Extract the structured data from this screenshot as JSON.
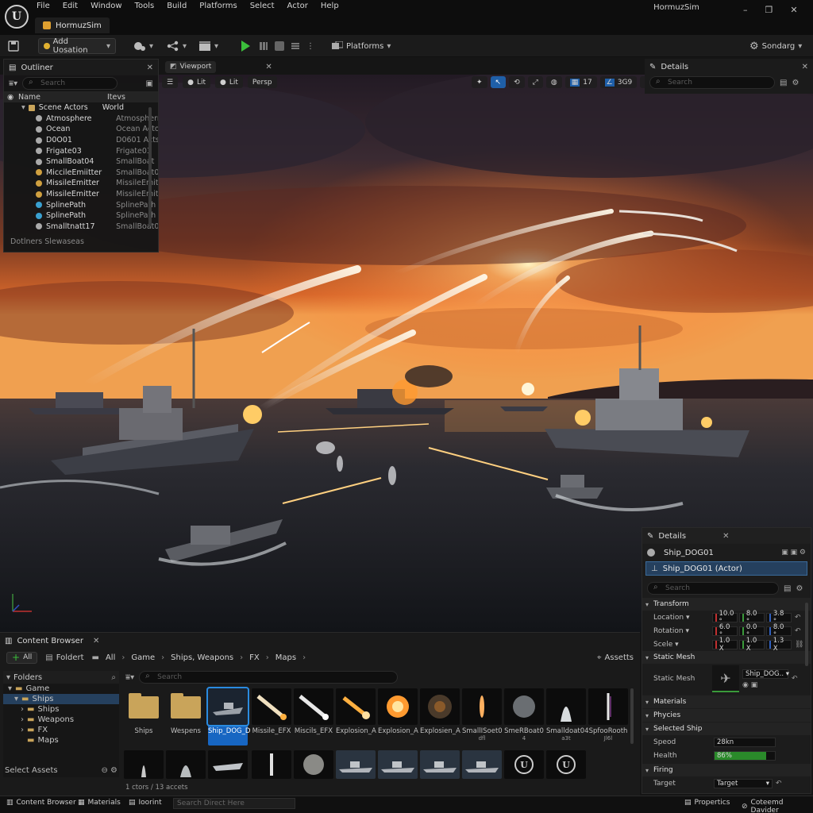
{
  "app": {
    "logo": "U",
    "menu": [
      "File",
      "Edit",
      "Window",
      "Tools",
      "Build",
      "Platforms",
      "Select",
      "Actor",
      "Help"
    ],
    "project_tab": "HormuzSim",
    "window_title": "HormuzSim",
    "win_controls": [
      "–",
      "❐",
      "✕"
    ]
  },
  "toolbar": {
    "add_label": "Add Uosation",
    "platforms_label": "Platforms",
    "settings_label": "Sondarg"
  },
  "outliner": {
    "title": "Outliner",
    "search_placeholder": "Search",
    "col_name": "Name",
    "col_type": "Itevs",
    "rows": [
      {
        "name": "Scene Actors",
        "type": "World"
      },
      {
        "name": "Atmosphere",
        "type": "Atmospherr"
      },
      {
        "name": "Ocean",
        "type": "Ocean Acto"
      },
      {
        "name": "D0O01",
        "type": "D0601 Acts"
      },
      {
        "name": "Frigate03",
        "type": "Frigate03"
      },
      {
        "name": "SmallBoat04",
        "type": "SmallBoat"
      },
      {
        "name": "MiccileEmiitter",
        "type": "SmallBoat0"
      },
      {
        "name": "MissileEmitter",
        "type": "MissileEmit"
      },
      {
        "name": "MissileEmitter",
        "type": "MissileEmit"
      },
      {
        "name": "SplinePath",
        "type": "SplinePath"
      },
      {
        "name": "SplinePath",
        "type": "SplinePath"
      },
      {
        "name": "Smalltnatt17",
        "type": "SmallBoat0"
      }
    ],
    "footer": "Dotlners Slewaseas"
  },
  "viewport": {
    "tab": "Viewport",
    "lit1": "Lit",
    "lit2": "Lit",
    "persp": "Persp",
    "grid_val": "17",
    "angle_val": "3G9"
  },
  "details_top": {
    "title": "Details",
    "search_placeholder": "Search"
  },
  "details": {
    "title": "Details",
    "actor_name": "Ship_DOG01",
    "actor_class": "Ship_DOG01 (Actor)",
    "search_placeholder": "Search",
    "transform": "Transform",
    "location_label": "Location",
    "location": [
      "10.0 °",
      "8.0 °",
      "3.8 °"
    ],
    "rotation_label": "Rotation",
    "rotation": [
      "6.0 °",
      "0.0 °",
      "8.0 °"
    ],
    "scale_label": "Scele",
    "scale": [
      "1.0 X",
      "1.0 X",
      "1.3 X"
    ],
    "static_mesh_section": "Static Mesh",
    "static_mesh_label": "Static Mesh",
    "static_mesh_value": "Ship_DOG..",
    "materials": "Materials",
    "physics": "Phycies",
    "selected_ship": "Selected Ship",
    "speed_label": "Speod",
    "speed_value": "28kn",
    "health_label": "Health",
    "health_value": "86%",
    "health_fraction": 0.86,
    "firing": "Firing",
    "target_label": "Target",
    "target_value": "Target"
  },
  "content": {
    "title": "Content Browser",
    "add_label": "All",
    "folder_btn": "Foldert",
    "breadcrumb": [
      "All",
      "Game",
      "Ships, Weapons",
      "FX",
      "Maps"
    ],
    "assets_btn": "Assetts",
    "search_placeholder": "Search",
    "folders_title": "Folders",
    "tree": [
      "Game",
      "Ships",
      "Ships",
      "Weapons",
      "FX",
      "Maps"
    ],
    "select_assets": "Select Assets",
    "count": "1 ctors / 13 accets",
    "assets": [
      {
        "name": "Ships",
        "sub": ""
      },
      {
        "name": "Wespens",
        "sub": ""
      },
      {
        "name": "Ship_DOG_D",
        "sub": ""
      },
      {
        "name": "Missile_EFX",
        "sub": ""
      },
      {
        "name": "Miscils_EFX",
        "sub": ""
      },
      {
        "name": "Explosion_A",
        "sub": ""
      },
      {
        "name": "Explosion_A",
        "sub": ""
      },
      {
        "name": "Explosien_A",
        "sub": ""
      },
      {
        "name": "SmallISoet0",
        "sub": "dfl"
      },
      {
        "name": "SmeRBoat0",
        "sub": "4"
      },
      {
        "name": "Smalldoat04",
        "sub": "a3t"
      },
      {
        "name": "SpfooRooth",
        "sub": "Jl6l"
      }
    ]
  },
  "statusbar": {
    "content_browser": "Content Browser",
    "materials": "Materials",
    "insert": "Ioorint",
    "search_placeholder": "Search Direct Here",
    "properties": "Propertics",
    "divider": "Coteemd Davider"
  }
}
